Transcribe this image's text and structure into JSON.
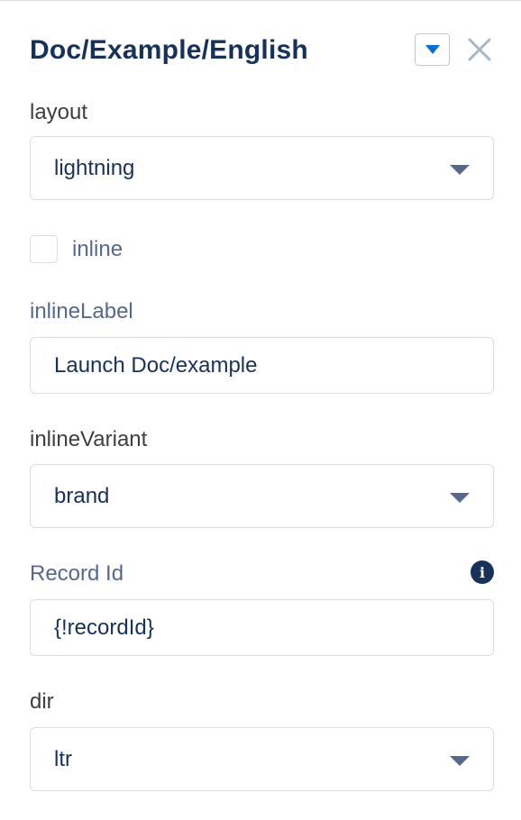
{
  "header": {
    "title": "Doc/Example/English",
    "menu_icon": "chevron-down-icon",
    "close_icon": "close-icon"
  },
  "fields": {
    "layout": {
      "label": "layout",
      "value": "lightning"
    },
    "inline": {
      "label": "inline",
      "checked": false
    },
    "inlineLabel": {
      "label": "inlineLabel",
      "value": "Launch Doc/example"
    },
    "inlineVariant": {
      "label": "inlineVariant",
      "value": "brand"
    },
    "recordId": {
      "label": "Record Id",
      "value": "{!recordId}",
      "info_icon": "info-icon"
    },
    "dir": {
      "label": "dir",
      "value": "ltr"
    }
  },
  "colors": {
    "title": "#16325c",
    "label_blue": "#54698d",
    "label_gray": "#3e3e3c",
    "border": "#d8dde6"
  }
}
